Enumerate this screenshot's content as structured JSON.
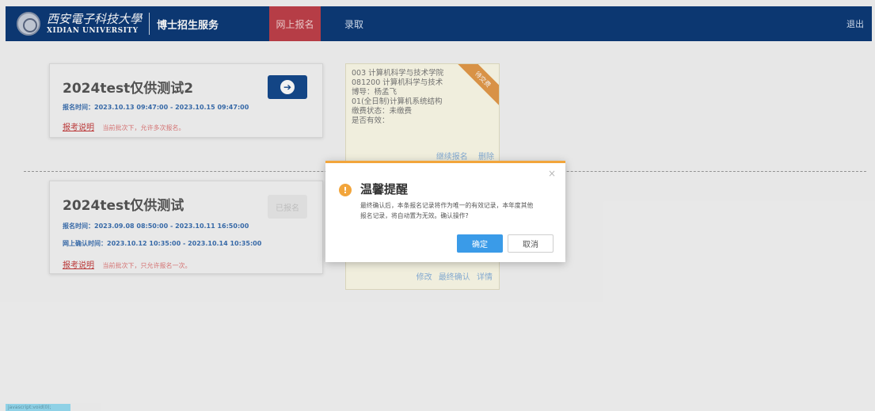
{
  "header": {
    "brand_cn": "西安電子科技大學",
    "brand_en": "XIDIAN UNIVERSITY",
    "service": "博士招生服务",
    "nav": [
      {
        "label": "网上报名"
      },
      {
        "label": "录取"
      }
    ],
    "logout": "退出"
  },
  "cards": [
    {
      "title": "2024test仅供测试2",
      "lines": [
        "报名时间：2023.10.13 09:47:00 - 2023.10.15 09:47:00"
      ],
      "notice_link": "报考说明",
      "notice_text": "当前批次下，允许多次报名。",
      "button_icon": "arrow-right-circle-icon"
    },
    {
      "title": "2024test仅供测试",
      "lines": [
        "报名时间：2023.09.08 08:50:00 - 2023.10.11 16:50:00",
        "网上确认时间：2023.10.12 10:35:00 - 2023.10.14 10:35:00"
      ],
      "notice_link": "报考说明",
      "notice_text": "当前批次下，只允许报名一次。",
      "button_label": "已报名"
    }
  ],
  "application": {
    "ribbon": "待交费",
    "lines": [
      "003 计算机科学与技术学院",
      "081200 计算机科学与技术",
      "博导：杨孟飞",
      "01(全日制)计算机系统结构",
      "缴费状态：未缴费",
      "是否有效："
    ],
    "actions_top": [
      "继续报名",
      "删除"
    ],
    "actions_bottom": [
      "修改",
      "最终确认",
      "详情"
    ]
  },
  "dialog": {
    "title": "温馨提醒",
    "message": "最终确认后，本条报名记录将作为唯一的有效记录，本年度其他报名记录，将自动置为无效。确认操作?",
    "ok": "确定",
    "cancel": "取消",
    "close": "×",
    "icon": "!"
  },
  "status_chip": "javascript:void(0);",
  "colors": {
    "header": "#0d3a78",
    "nav_active": "#c0414a",
    "accent": "#3a9be8",
    "warning": "#f2a53b"
  }
}
